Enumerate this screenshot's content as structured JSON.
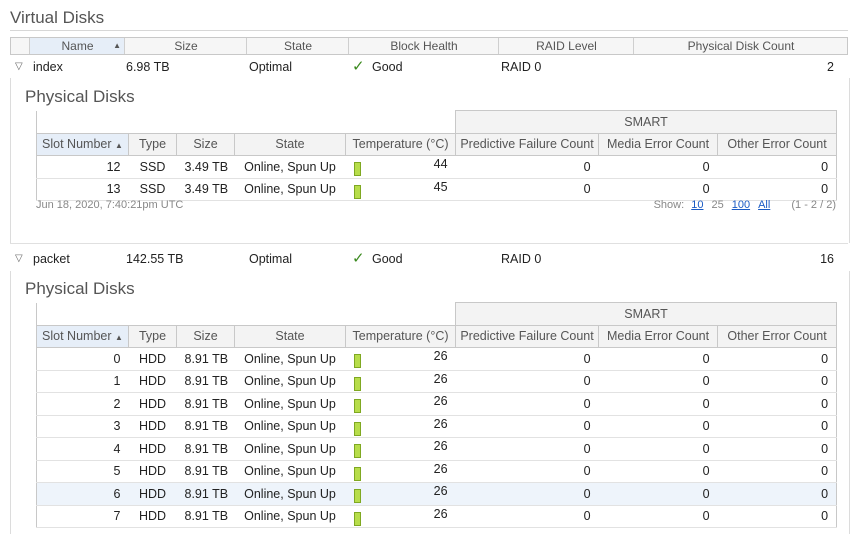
{
  "page": {
    "title": "Virtual Disks"
  },
  "vd_columns": [
    "Name",
    "Size",
    "State",
    "Block Health",
    "RAID Level",
    "Physical Disk Count"
  ],
  "vd_sort_icon": "▲",
  "pd_columns": {
    "slot": "Slot Number",
    "type": "Type",
    "size": "Size",
    "state": "State",
    "temp": "Temperature (°C)",
    "smart": "SMART",
    "pfc": "Predictive Failure Count",
    "mec": "Media Error Count",
    "oec": "Other Error Count"
  },
  "virtual_disks": [
    {
      "name": "index",
      "size": "6.98 TB",
      "state": "Optimal",
      "health": "Good",
      "raid": "RAID 0",
      "count": "2",
      "section_title": "Physical Disks",
      "disks": [
        {
          "slot": "12",
          "type": "SSD",
          "size": "3.49 TB",
          "state": "Online, Spun Up",
          "temp": "44",
          "pfc": "0",
          "mec": "0",
          "oec": "0"
        },
        {
          "slot": "13",
          "type": "SSD",
          "size": "3.49 TB",
          "state": "Online, Spun Up",
          "temp": "45",
          "pfc": "0",
          "mec": "0",
          "oec": "0"
        }
      ],
      "timestamp": "Jun 18, 2020, 7:40:21pm UTC",
      "pager": {
        "show_label": "Show:",
        "opt_10": "10",
        "opt_25": "25",
        "opt_100": "100",
        "opt_all": "All",
        "range": "(1 - 2 / 2)"
      }
    },
    {
      "name": "packet",
      "size": "142.55 TB",
      "state": "Optimal",
      "health": "Good",
      "raid": "RAID 0",
      "count": "16",
      "section_title": "Physical Disks",
      "disks": [
        {
          "slot": "0",
          "type": "HDD",
          "size": "8.91 TB",
          "state": "Online, Spun Up",
          "temp": "26",
          "pfc": "0",
          "mec": "0",
          "oec": "0"
        },
        {
          "slot": "1",
          "type": "HDD",
          "size": "8.91 TB",
          "state": "Online, Spun Up",
          "temp": "26",
          "pfc": "0",
          "mec": "0",
          "oec": "0"
        },
        {
          "slot": "2",
          "type": "HDD",
          "size": "8.91 TB",
          "state": "Online, Spun Up",
          "temp": "26",
          "pfc": "0",
          "mec": "0",
          "oec": "0"
        },
        {
          "slot": "3",
          "type": "HDD",
          "size": "8.91 TB",
          "state": "Online, Spun Up",
          "temp": "26",
          "pfc": "0",
          "mec": "0",
          "oec": "0"
        },
        {
          "slot": "4",
          "type": "HDD",
          "size": "8.91 TB",
          "state": "Online, Spun Up",
          "temp": "26",
          "pfc": "0",
          "mec": "0",
          "oec": "0"
        },
        {
          "slot": "5",
          "type": "HDD",
          "size": "8.91 TB",
          "state": "Online, Spun Up",
          "temp": "26",
          "pfc": "0",
          "mec": "0",
          "oec": "0"
        },
        {
          "slot": "6",
          "type": "HDD",
          "size": "8.91 TB",
          "state": "Online, Spun Up",
          "temp": "26",
          "pfc": "0",
          "mec": "0",
          "oec": "0"
        },
        {
          "slot": "7",
          "type": "HDD",
          "size": "8.91 TB",
          "state": "Online, Spun Up",
          "temp": "26",
          "pfc": "0",
          "mec": "0",
          "oec": "0"
        }
      ]
    }
  ],
  "icons": {
    "expand": "▽",
    "check": "✓",
    "sort_asc": "▲"
  },
  "colors": {
    "health_good": "#3b8a1f",
    "link": "#1a5bc4",
    "temp_bar": "#b7dd4a",
    "row_highlight": "#eef4fb"
  }
}
